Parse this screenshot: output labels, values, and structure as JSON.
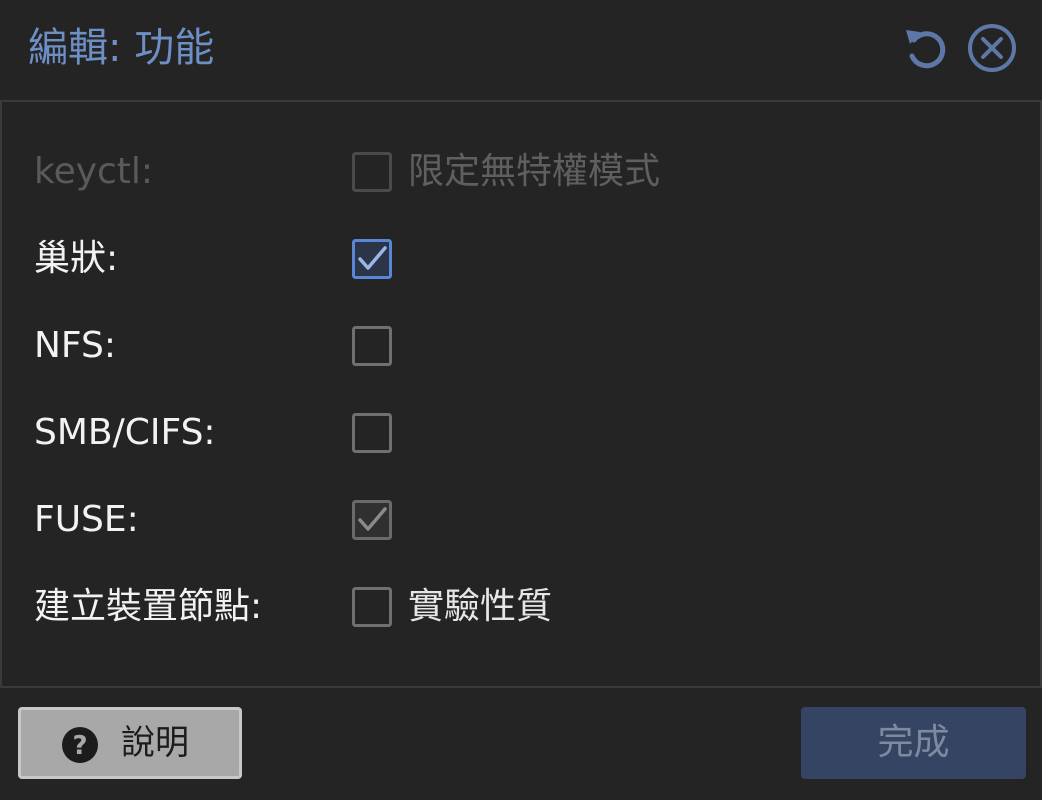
{
  "window": {
    "title": "編輯: 功能"
  },
  "toolbar": {
    "reset_icon": "undo-icon",
    "close_icon": "close-circle-icon"
  },
  "colors": {
    "accent": "#6e8fc6",
    "background": "#242424",
    "checked_blue": "#5a86d6",
    "disabled": "#5a5a5a"
  },
  "options": [
    {
      "label": "keyctl:",
      "checked": false,
      "disabled": true,
      "box_label": "限定無特權模式"
    },
    {
      "label": "巢狀:",
      "checked": true,
      "disabled": false,
      "box_label": ""
    },
    {
      "label": "NFS:",
      "checked": false,
      "disabled": false,
      "box_label": ""
    },
    {
      "label": "SMB/CIFS:",
      "checked": false,
      "disabled": false,
      "box_label": ""
    },
    {
      "label": "FUSE:",
      "checked": true,
      "disabled": false,
      "box_label": ""
    },
    {
      "label": "建立裝置節點:",
      "checked": false,
      "disabled": false,
      "box_label": "實驗性質"
    }
  ],
  "footer": {
    "help_label": "說明",
    "help_icon": "question-circle-icon",
    "done_label": "完成"
  }
}
